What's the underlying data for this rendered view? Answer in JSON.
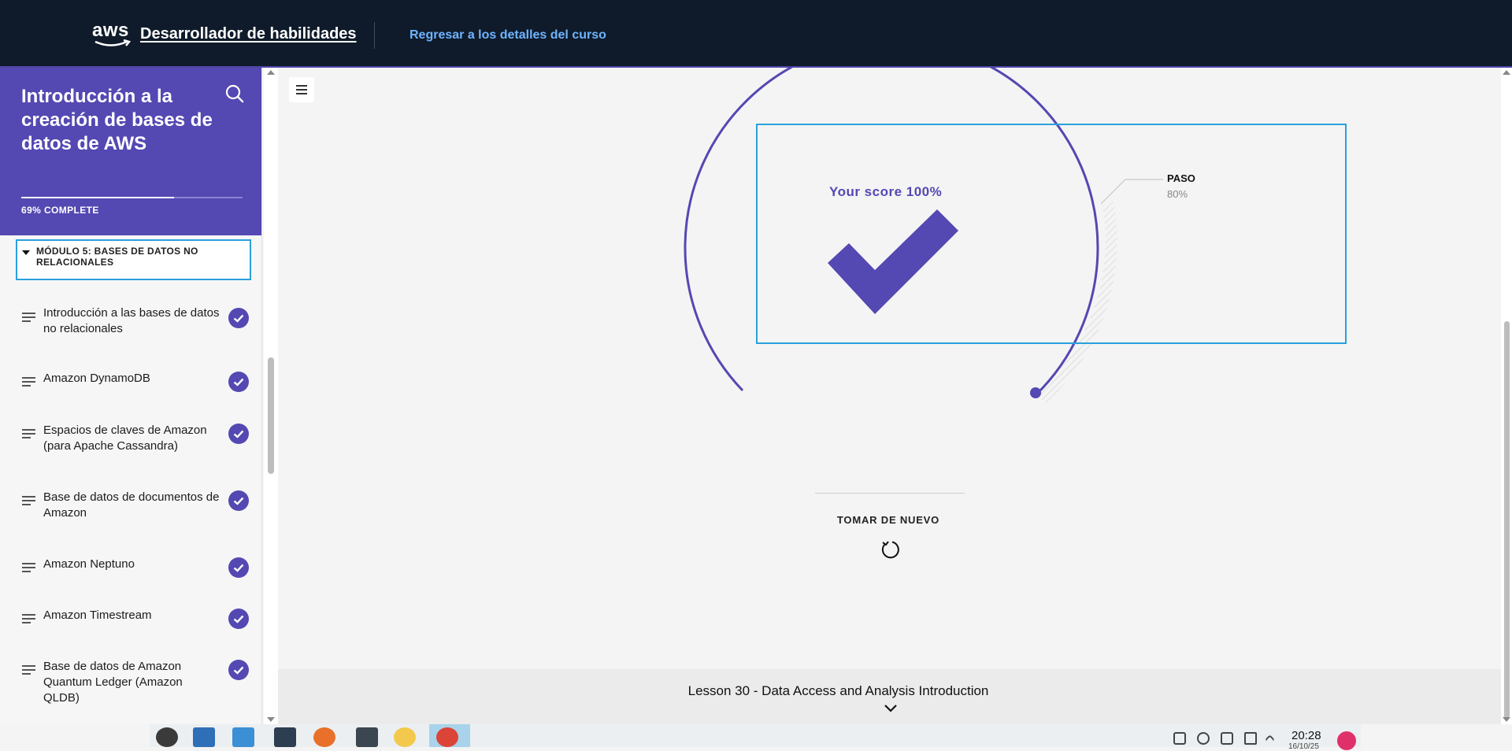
{
  "header": {
    "logo_text": "aws",
    "app_title": "Desarrollador de habilidades",
    "back_link": "Regresar a los detalles del curso"
  },
  "sidebar": {
    "course_title": "Introducción a la creación de bases de datos de AWS",
    "progress_fraction": 0.69,
    "progress_label": "69% COMPLETE",
    "module_label": "MÓDULO 5: BASES DE DATOS NO RELACIONALES",
    "lessons": [
      {
        "label": "Introducción a las bases de datos no relacionales",
        "completed": true
      },
      {
        "label": "Amazon DynamoDB",
        "completed": true
      },
      {
        "label": "Espacios de claves de Amazon (para Apache Cassandra)",
        "completed": true
      },
      {
        "label": "Base de datos de documentos de Amazon",
        "completed": true
      },
      {
        "label": "Amazon Neptuno",
        "completed": true
      },
      {
        "label": "Amazon Timestream",
        "completed": true
      },
      {
        "label": "Base de datos de Amazon Quantum Ledger (Amazon QLDB)",
        "completed": true
      }
    ]
  },
  "quiz_result": {
    "score_label": "Your score 100%",
    "score_fraction": 1.0,
    "pass_label": "PASO",
    "pass_value": "80%",
    "retry_label": "TOMAR DE NUEVO"
  },
  "next_lesson": {
    "label": "Lesson 30 - Data Access and Analysis Introduction"
  },
  "taskbar": {
    "time": "20:28",
    "date": "16/10/25"
  },
  "colors": {
    "accent": "#5448b2",
    "header_bg": "#0f1b2a",
    "link": "#6fb4ff",
    "focus": "#2aa0dc"
  }
}
